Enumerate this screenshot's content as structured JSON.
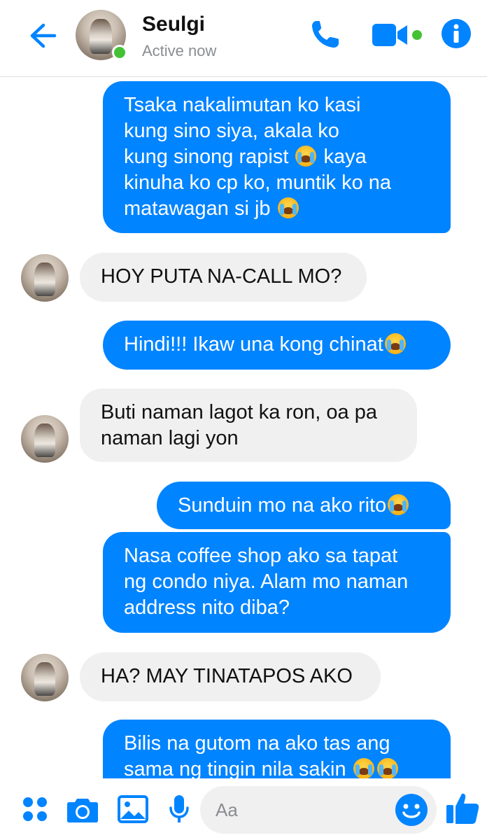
{
  "header": {
    "contact_name": "Seulgi",
    "status": "Active now",
    "icons": [
      "back-arrow-icon",
      "phone-icon",
      "video-camera-icon",
      "info-icon"
    ]
  },
  "messages": [
    {
      "direction": "outgoing",
      "lines": [
        "Tsaka nakalimutan ko kasi",
        "kung sino siya, akala ko",
        "kung sinong rapist",
        "kaya",
        "kinuha ko cp ko, muntik ko na",
        "matawagan si jb"
      ]
    },
    {
      "direction": "incoming",
      "text": "HOY PUTA NA-CALL MO?"
    },
    {
      "direction": "outgoing",
      "text": "Hindi!!! Ikaw una kong chinat"
    },
    {
      "direction": "incoming",
      "lines": [
        "Buti naman lagot ka ron, oa pa",
        "naman lagi yon"
      ]
    },
    {
      "direction": "outgoing",
      "text": "Sunduin mo na ako rito"
    },
    {
      "direction": "outgoing",
      "lines": [
        "Nasa coffee shop ako sa tapat",
        "ng condo niya. Alam mo naman",
        "address nito diba?"
      ]
    },
    {
      "direction": "incoming",
      "text": "HA? MAY TINATAPOS AKO"
    },
    {
      "direction": "outgoing",
      "lines": [
        "Bilis na gutom na ako tas ang",
        "sama ng tingin nila sakin"
      ]
    }
  ],
  "composer": {
    "placeholder": "Aa",
    "icons": [
      "apps-grid-icon",
      "camera-icon",
      "gallery-icon",
      "microphone-icon",
      "emoji-smile-icon",
      "thumbs-up-icon"
    ]
  },
  "colors": {
    "accent": "#0084ff",
    "incoming_bubble": "#f1f0f0",
    "online": "#44c234"
  }
}
